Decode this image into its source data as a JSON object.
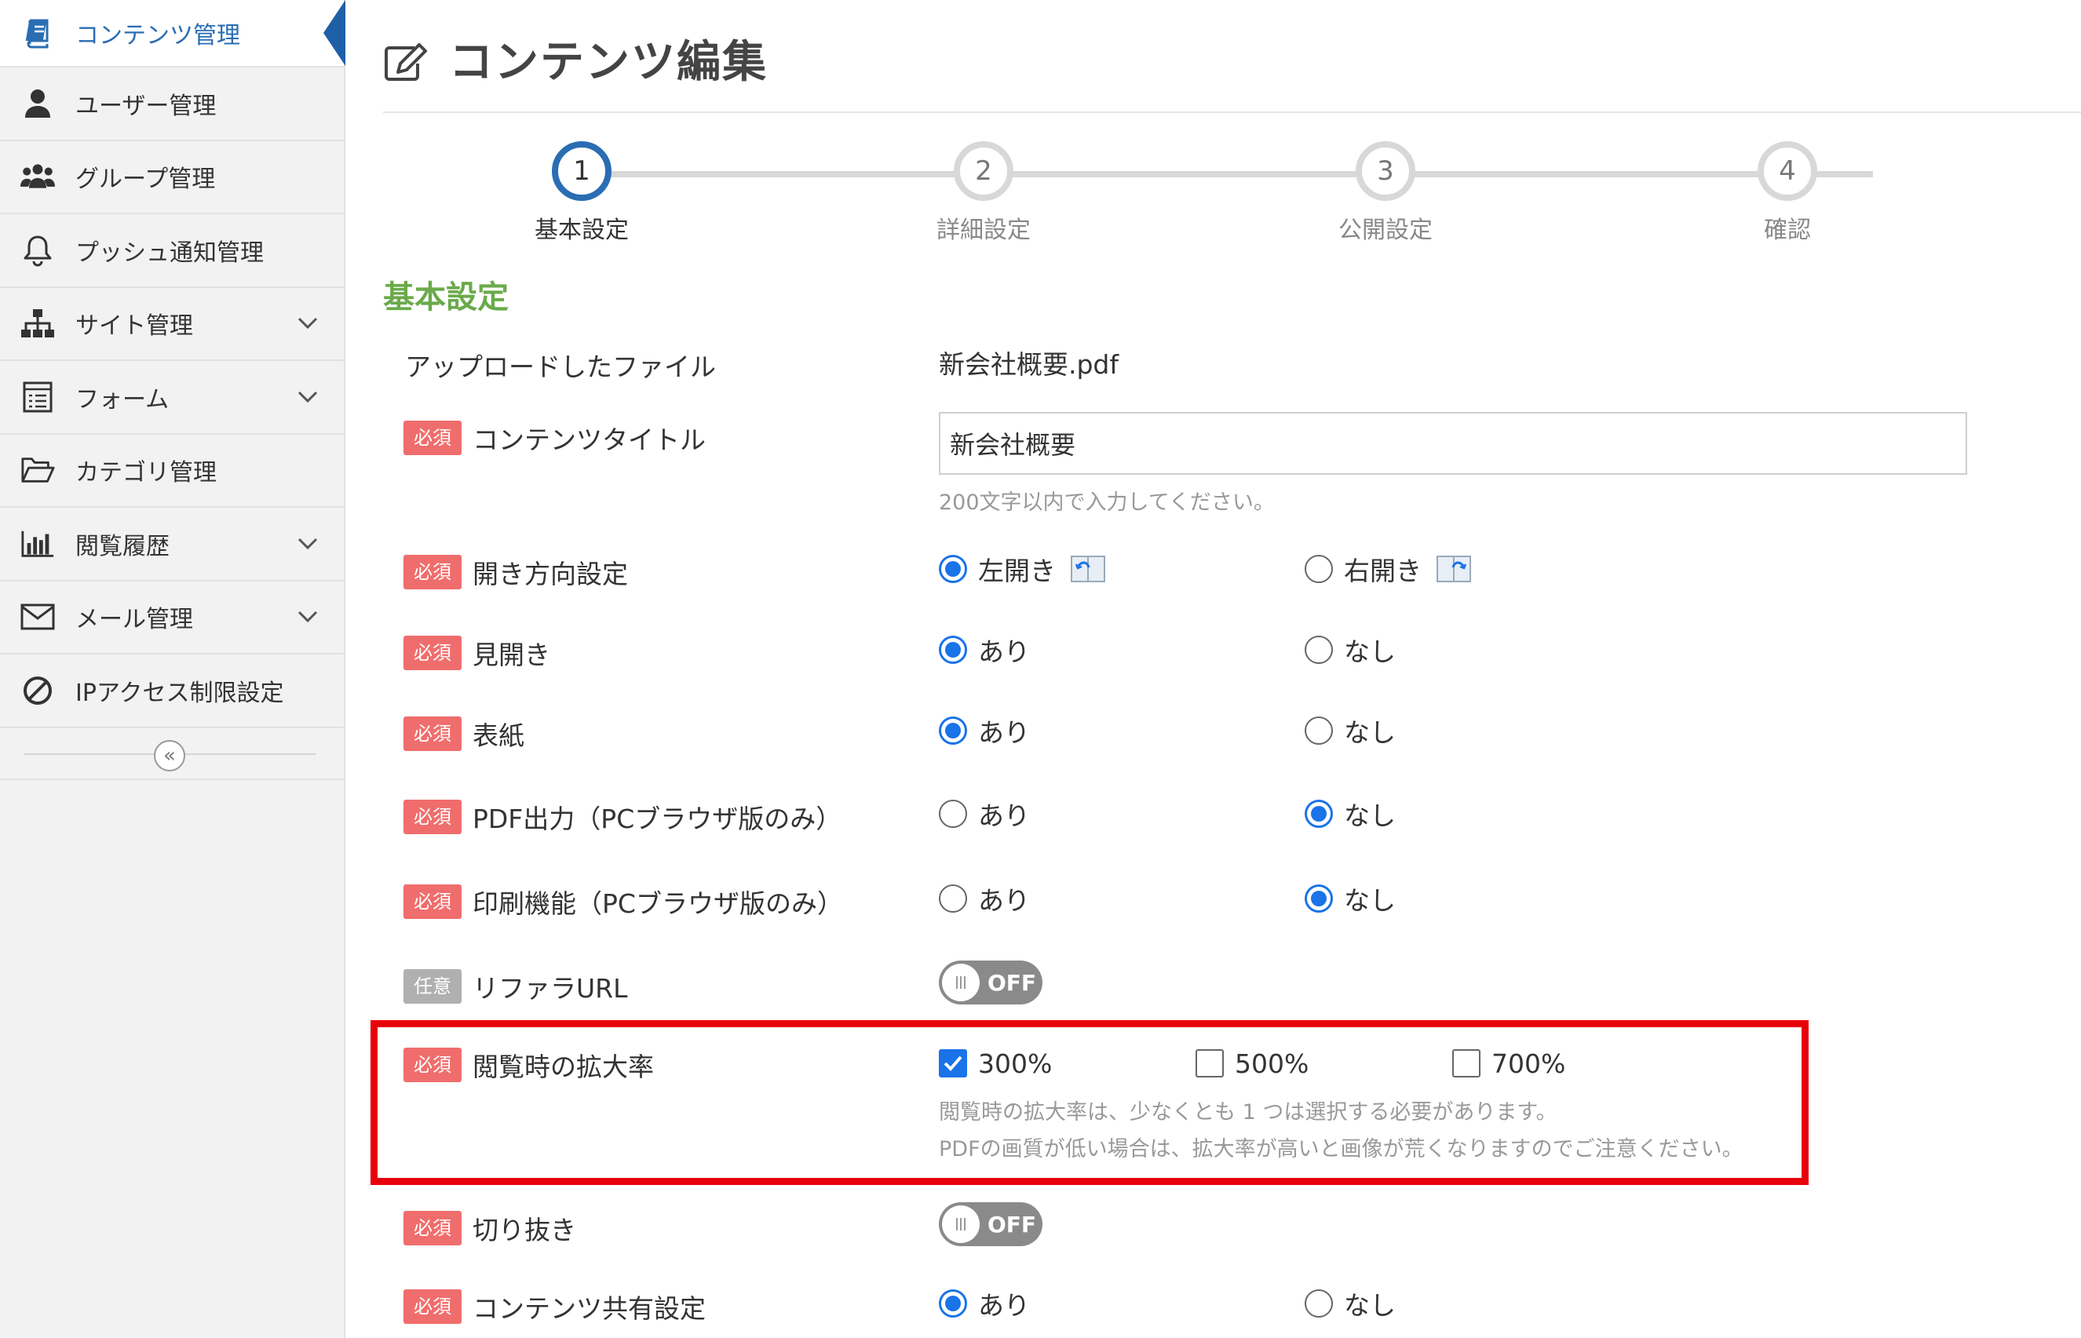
{
  "sidebar": {
    "items": [
      {
        "label": "コンテンツ管理",
        "icon": "book-icon",
        "active": true,
        "chevron": false
      },
      {
        "label": "ユーザー管理",
        "icon": "user-icon",
        "active": false,
        "chevron": false
      },
      {
        "label": "グループ管理",
        "icon": "users-icon",
        "active": false,
        "chevron": false
      },
      {
        "label": "プッシュ通知管理",
        "icon": "bell-icon",
        "active": false,
        "chevron": false
      },
      {
        "label": "サイト管理",
        "icon": "sitemap-icon",
        "active": false,
        "chevron": true
      },
      {
        "label": "フォーム",
        "icon": "form-icon",
        "active": false,
        "chevron": true
      },
      {
        "label": "カテゴリ管理",
        "icon": "folder-open-icon",
        "active": false,
        "chevron": false
      },
      {
        "label": "閲覧履歴",
        "icon": "bar-chart-icon",
        "active": false,
        "chevron": true
      },
      {
        "label": "メール管理",
        "icon": "envelope-icon",
        "active": false,
        "chevron": true
      },
      {
        "label": "IPアクセス制限設定",
        "icon": "ban-icon",
        "active": false,
        "chevron": false
      }
    ],
    "collapse_glyph": "«"
  },
  "header": {
    "title": "コンテンツ編集"
  },
  "stepper": {
    "steps": [
      {
        "number": "1",
        "label": "基本設定",
        "active": true
      },
      {
        "number": "2",
        "label": "詳細設定",
        "active": false
      },
      {
        "number": "3",
        "label": "公開設定",
        "active": false
      },
      {
        "number": "4",
        "label": "確認",
        "active": false
      }
    ]
  },
  "section_title": "基本設定",
  "badges": {
    "required": "必須",
    "optional": "任意"
  },
  "form": {
    "uploaded_file": {
      "label": "アップロードしたファイル",
      "value": "新会社概要.pdf"
    },
    "content_title": {
      "label": "コンテンツタイトル",
      "value": "新会社概要",
      "help": "200文字以内で入力してください。"
    },
    "open_direction": {
      "label": "開き方向設定",
      "options": [
        "左開き",
        "右開き"
      ],
      "selected": 0
    },
    "spread": {
      "label": "見開き",
      "options": [
        "あり",
        "なし"
      ],
      "selected": 0
    },
    "cover": {
      "label": "表紙",
      "options": [
        "あり",
        "なし"
      ],
      "selected": 0
    },
    "pdf_output": {
      "label": "PDF出力（PCブラウザ版のみ）",
      "options": [
        "あり",
        "なし"
      ],
      "selected": 1
    },
    "print": {
      "label": "印刷機能（PCブラウザ版のみ）",
      "options": [
        "あり",
        "なし"
      ],
      "selected": 1
    },
    "referrer_url": {
      "label": "リファラURL",
      "toggle": "OFF"
    },
    "zoom_rate": {
      "label": "閲覧時の拡大率",
      "options": [
        "300%",
        "500%",
        "700%"
      ],
      "checked": [
        true,
        false,
        false
      ],
      "help_1": "閲覧時の拡大率は、少なくとも 1 つは選択する必要があります。",
      "help_2": "PDFの画質が低い場合は、拡大率が高いと画像が荒くなりますのでご注意ください。"
    },
    "crop": {
      "label": "切り抜き",
      "toggle": "OFF"
    },
    "content_share": {
      "label": "コンテンツ共有設定",
      "options": [
        "あり",
        "なし"
      ],
      "selected": 0
    }
  },
  "colors": {
    "accent_blue": "#2a6db3",
    "radio_blue": "#1a73e8",
    "required_badge": "#f06d6d",
    "optional_badge": "#b0b0b0",
    "section_green": "#6aaa4a",
    "highlight_red": "#e8000a"
  }
}
